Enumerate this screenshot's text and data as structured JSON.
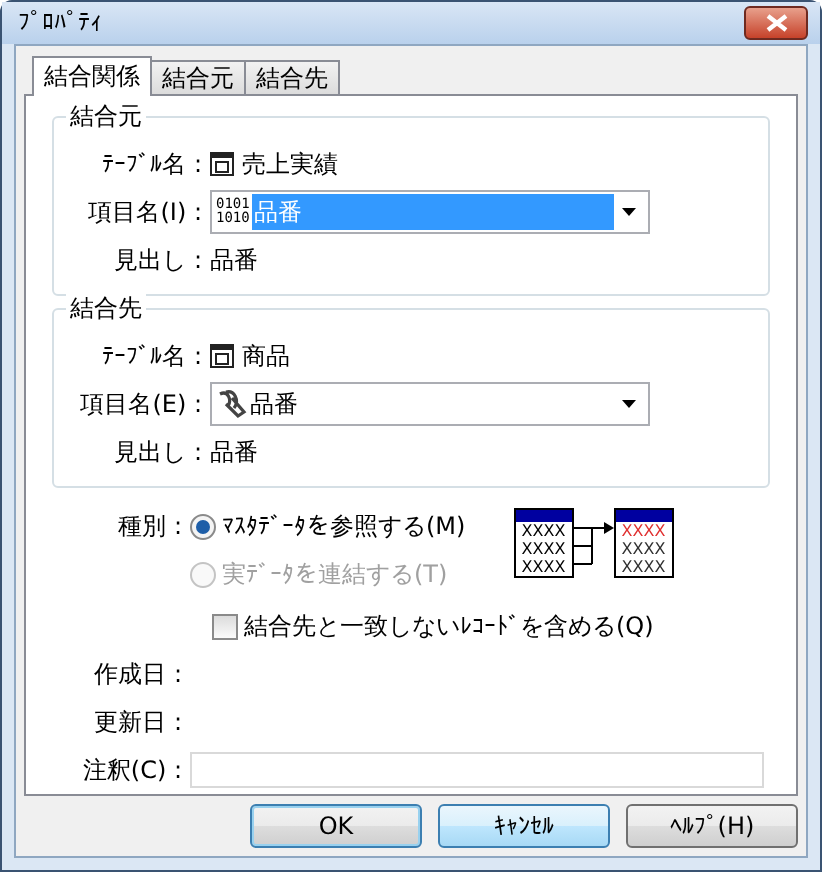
{
  "window": {
    "title": "ﾌﾟﾛﾊﾟﾃｨ"
  },
  "tabs": [
    {
      "label": "結合関係",
      "selected": true
    },
    {
      "label": "結合元",
      "selected": false
    },
    {
      "label": "結合先",
      "selected": false
    }
  ],
  "groups": [
    {
      "title": "結合元",
      "table_label": "ﾃｰﾌﾞﾙ名 :",
      "table_name": "売上実績",
      "field_label": "項目名(I) :",
      "field": {
        "kind": "binary",
        "badge": [
          "0101",
          "1010"
        ],
        "value": "品番",
        "selected": true
      },
      "caption_label": "見出し :",
      "caption": "品番"
    },
    {
      "title": "結合先",
      "table_label": "ﾃｰﾌﾞﾙ名 :",
      "table_name": "商品",
      "field_label": "項目名(E) :",
      "field": {
        "kind": "link",
        "value": "品番",
        "selected": false
      },
      "caption_label": "見出し :",
      "caption": "品番"
    }
  ],
  "join_type": {
    "label": "種別 :",
    "options": [
      {
        "label": "ﾏｽﾀﾃﾞｰﾀを参照する(M)",
        "selected": true,
        "disabled": false
      },
      {
        "label": "実ﾃﾞｰﾀを連結する(T)",
        "selected": false,
        "disabled": true
      }
    ]
  },
  "diagram": {
    "left_rows": [
      "XXXX",
      "XXXX",
      "XXXX"
    ],
    "right_rows": [
      {
        "text": "XXXX",
        "color": "#e03030"
      },
      {
        "text": "XXXX",
        "color": "#303030"
      },
      {
        "text": "XXXX",
        "color": "#303030"
      }
    ]
  },
  "include_unmatched": {
    "label": "結合先と一致しないﾚｺｰﾄﾞを含める(Q)",
    "checked": false
  },
  "dates": [
    {
      "label": "作成日 :"
    },
    {
      "label": "更新日 :"
    }
  ],
  "note": {
    "label": "注釈(C) :",
    "disabled": true
  },
  "buttons": [
    {
      "label": "OK",
      "default": true,
      "hovered": false
    },
    {
      "label": "ｷｬﾝｾﾙ",
      "default": false,
      "hovered": true
    },
    {
      "label": "ﾍﾙﾌﾟ(H)",
      "default": false,
      "hovered": false
    }
  ]
}
